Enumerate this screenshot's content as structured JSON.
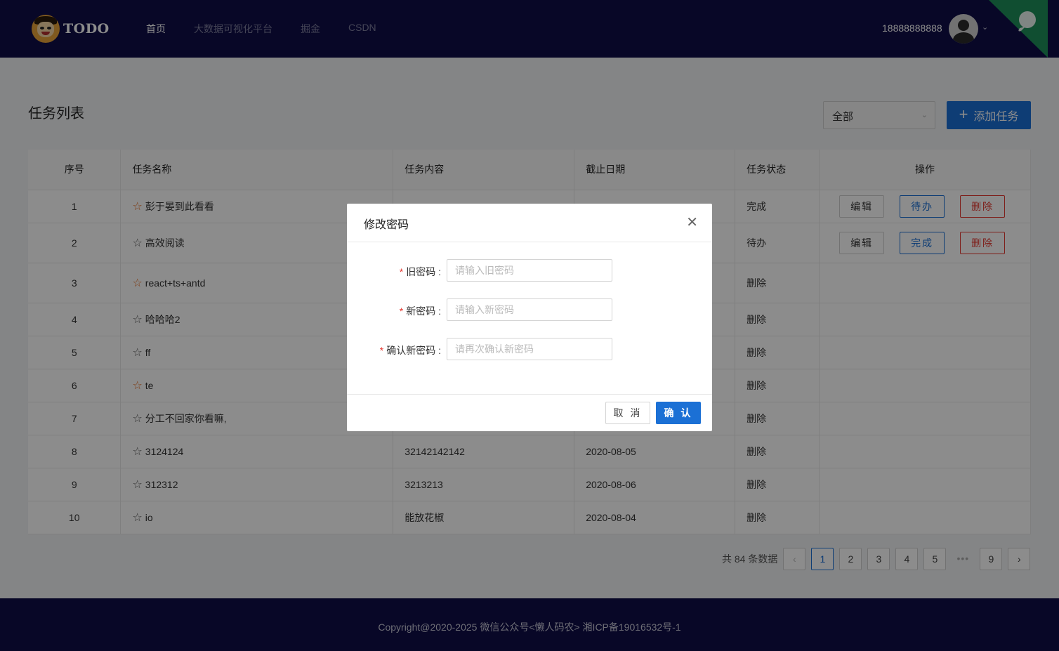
{
  "header": {
    "brand": "TODO",
    "nav": [
      "首页",
      "大数据可视化平台",
      "掘金",
      "CSDN"
    ],
    "phone": "18888888888"
  },
  "main": {
    "title": "任务列表",
    "filter_value": "全部",
    "add_label": "添加任务",
    "columns": [
      "序号",
      "任务名称",
      "任务内容",
      "截止日期",
      "任务状态",
      "操作"
    ],
    "rows": [
      {
        "no": "1",
        "name": "彭于晏到此看看",
        "content": "",
        "date": "",
        "status": "完成",
        "star": "orange",
        "actions": [
          "编辑",
          "待办",
          "删除"
        ]
      },
      {
        "no": "2",
        "name": "高效阅读",
        "content": "",
        "date": "",
        "status": "待办",
        "star": "gray",
        "actions": [
          "编辑",
          "完成",
          "删除"
        ]
      },
      {
        "no": "3",
        "name": "react+ts+antd",
        "content": "",
        "date": "",
        "status": "删除",
        "star": "orange",
        "actions": []
      },
      {
        "no": "4",
        "name": "哈哈哈2",
        "content": "",
        "date": "",
        "status": "删除",
        "star": "gray",
        "actions": []
      },
      {
        "no": "5",
        "name": "ff",
        "content": "",
        "date": "",
        "status": "删除",
        "star": "gray",
        "actions": []
      },
      {
        "no": "6",
        "name": "te",
        "content": "",
        "date": "",
        "status": "删除",
        "star": "orange",
        "actions": []
      },
      {
        "no": "7",
        "name": "分工不回家你看嘛,",
        "content": "",
        "date": "",
        "status": "删除",
        "star": "gray",
        "actions": []
      },
      {
        "no": "8",
        "name": "3124124",
        "content": "32142142142",
        "date": "2020-08-05",
        "status": "删除",
        "star": "gray",
        "actions": []
      },
      {
        "no": "9",
        "name": "312312",
        "content": "3213213",
        "date": "2020-08-06",
        "status": "删除",
        "star": "gray",
        "actions": []
      },
      {
        "no": "10",
        "name": "io",
        "content": "能放花椒",
        "date": "2020-08-04",
        "status": "删除",
        "star": "gray",
        "actions": []
      }
    ],
    "pagination": {
      "total_text": "共 84 条数据",
      "pages": [
        "1",
        "2",
        "3",
        "4",
        "5",
        "•••",
        "9"
      ],
      "current": "1"
    }
  },
  "modal": {
    "title": "修改密码",
    "fields": [
      {
        "label": "旧密码",
        "placeholder": "请输入旧密码"
      },
      {
        "label": "新密码",
        "placeholder": "请输入新密码"
      },
      {
        "label": "确认新密码",
        "placeholder": "请再次确认新密码"
      }
    ],
    "cancel_label": "取 消",
    "ok_label": "确 认"
  },
  "footer": {
    "text": "Copyright@2020-2025 微信公众号<懒人码农> 湘ICP备19016532号-1"
  },
  "colors": {
    "header_bg": "#0f0e47",
    "primary": "#1b70d5",
    "danger": "#e5372f",
    "star_active": "#e56a1f",
    "corner": "#1e8f5a"
  }
}
